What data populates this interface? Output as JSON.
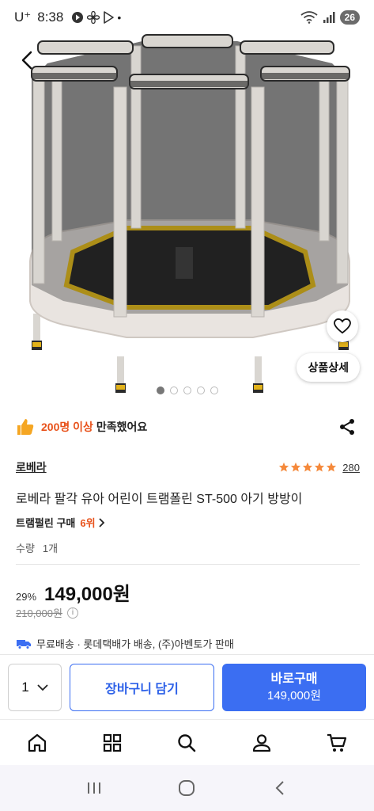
{
  "status_bar": {
    "carrier": "U⁺",
    "time": "8:38",
    "battery": "26"
  },
  "hero": {
    "detail_button": "상품상세",
    "image_dots": 5,
    "active_dot": 0
  },
  "satisfaction": {
    "count": "200명 이상",
    "text": "만족했어요"
  },
  "product": {
    "brand": "로베라",
    "rating": 5,
    "review_count": "280",
    "title": "로베라 팔각 유아 어린이 트램폴린 ST-500 아기 방방이",
    "rank_label": "트램펄린 구매",
    "rank_value": "6위",
    "qty_label": "수량",
    "qty_value": "1개",
    "discount": "29%",
    "price": "149,000원",
    "original_price": "210,000원",
    "shipping": "무료배송 · 롯데택배가 배송, (주)아벤토가 판매"
  },
  "purchase_bar": {
    "qty": "1",
    "cart_label": "장바구니 담기",
    "buy_label": "바로구매",
    "buy_price": "149,000원"
  },
  "tabs": [
    "home-icon",
    "category-icon",
    "search-icon",
    "my-page-icon",
    "cart-icon"
  ],
  "colors": {
    "accent_blue": "#3b6ef2",
    "accent_orange": "#e8521b",
    "star": "#f5893b"
  }
}
